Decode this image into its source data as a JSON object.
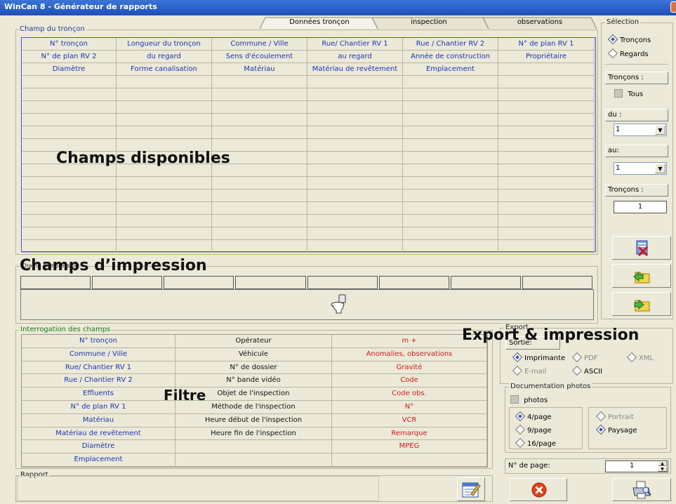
{
  "window": {
    "title": "WinCan 8 - Générateur de rapports"
  },
  "tabs": [
    {
      "label": "Données tronçon",
      "active": true
    },
    {
      "label": "inspection",
      "active": false
    },
    {
      "label": "observations",
      "active": false
    }
  ],
  "champ_troncon": {
    "legend": "Champ du tronçon",
    "rows": [
      [
        "N° tronçon",
        "Longueur du tronçon",
        "Commune / Ville",
        "Rue/ Chantier RV 1",
        "Rue / Chantier RV 2",
        "N° de plan RV 1"
      ],
      [
        "N° de plan RV 2",
        "du regard",
        "Sens d'écoulement",
        "au regard",
        "Année de construction",
        "Propriétaire"
      ],
      [
        "Diamètre",
        "Forme canalisation",
        "Matériau",
        "Matériau de revêtement",
        "Emplacement",
        ""
      ]
    ]
  },
  "champ_impression": {
    "legend": "Champ d'impression"
  },
  "selection": {
    "legend": "Sélection",
    "options": [
      {
        "label": "Tronçons",
        "selected": true
      },
      {
        "label": "Regards",
        "selected": false
      }
    ],
    "troncons_btn": "Tronçons :",
    "tous": "Tous",
    "du_btn": "du :",
    "du_value": "1",
    "au_btn": "au:",
    "au_value": "1",
    "troncons_count_btn": "Tronçons :",
    "troncons_count": "1"
  },
  "interrogation": {
    "legend": "Interrogation des champs",
    "col1": [
      "N° tronçon",
      "Commune / Ville",
      "Rue/ Chantier RV 1",
      "Rue / Chantier RV 2",
      "Effluents",
      "N° de plan RV 1",
      "Matériau",
      "Matériau de revêtement",
      "Diamètre",
      "Emplacement"
    ],
    "col2": [
      "Opérateur",
      "Véhicule",
      "N° de dossier",
      "N° bande vidéo",
      "Objet de l'inspection",
      "Méthode de l'inspection",
      "Heure début de l'inspection",
      "Heure fin de l'inspection",
      "",
      ""
    ],
    "col3": [
      "m +",
      "Anomalies, observations",
      "Gravité",
      "Code",
      "Code obs.",
      "N°",
      "VCR",
      "Remarque",
      "MPEG",
      ""
    ]
  },
  "export": {
    "legend": "Export",
    "sortie_btn": "Sortie:",
    "options": [
      {
        "label": "Imprimante",
        "selected": true
      },
      {
        "label": "PDF",
        "selected": false
      },
      {
        "label": "XML",
        "selected": false
      },
      {
        "label": "E-mail",
        "selected": false
      },
      {
        "label": "ASCII",
        "selected": false
      }
    ]
  },
  "doc_photos": {
    "legend": "Documentation photos",
    "photos": "photos",
    "per_page": [
      {
        "label": "4/page",
        "selected": true
      },
      {
        "label": "9/page",
        "selected": false
      },
      {
        "label": "16/page",
        "selected": false
      }
    ],
    "orientation": [
      {
        "label": "Portrait",
        "selected": false
      },
      {
        "label": "Paysage",
        "selected": true
      }
    ]
  },
  "page_no": {
    "label": "N° de page:",
    "value": "1"
  },
  "rapport": {
    "legend": "Rapport"
  },
  "overlays": {
    "champs_disponibles": "Champs disponibles",
    "champs_impression": "Champs d’impression",
    "export_impression": "Export & impression",
    "filtre": "Filtre"
  },
  "icons": [
    "delete-doc-icon",
    "folder-back-icon",
    "folder-forward-icon",
    "toilet-icon",
    "report-edit-icon",
    "cancel-icon",
    "print-preview-icon"
  ],
  "colors": {
    "title_bar": "#1f4fb8",
    "blue_text": "#1b36b5",
    "red_text": "#d11b1b",
    "background": "#ece9d8"
  }
}
